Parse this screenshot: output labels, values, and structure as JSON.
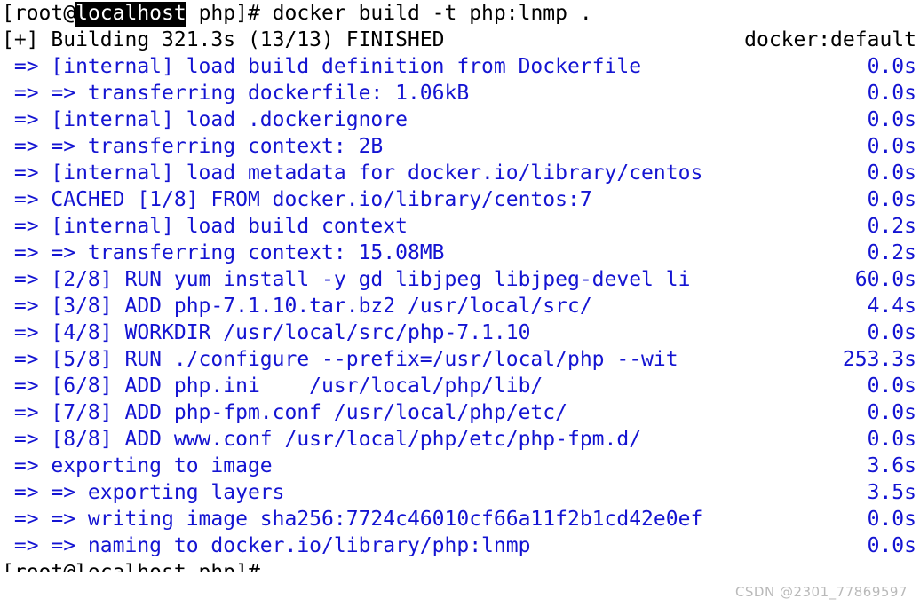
{
  "terminal": {
    "background_color": "#ffffff",
    "default_text_color": "#000000",
    "progress_text_color": "#1414d2",
    "prompt": {
      "prefix": "[root@",
      "host": "localhost",
      "suffix": " php]# ",
      "command": "docker build -t php:lnmp ."
    },
    "status_line": {
      "text": "[+] Building 321.3s (13/13) FINISHED",
      "right": "docker:default"
    },
    "trailing_prompt": "[root@localhost php]# ",
    "lines": [
      {
        "text": " => [internal] load build definition from Dockerfile",
        "time": "0.0s",
        "color": "blue"
      },
      {
        "text": " => => transferring dockerfile: 1.06kB",
        "time": "0.0s",
        "color": "blue"
      },
      {
        "text": " => [internal] load .dockerignore",
        "time": "0.0s",
        "color": "blue"
      },
      {
        "text": " => => transferring context: 2B",
        "time": "0.0s",
        "color": "blue"
      },
      {
        "text": " => [internal] load metadata for docker.io/library/centos",
        "time": "0.0s",
        "color": "blue"
      },
      {
        "text": " => CACHED [1/8] FROM docker.io/library/centos:7",
        "time": "0.0s",
        "color": "blue"
      },
      {
        "text": " => [internal] load build context",
        "time": "0.2s",
        "color": "blue"
      },
      {
        "text": " => => transferring context: 15.08MB",
        "time": "0.2s",
        "color": "blue"
      },
      {
        "text": " => [2/8] RUN yum install -y gd libjpeg libjpeg-devel li",
        "time": "60.0s",
        "color": "blue"
      },
      {
        "text": " => [3/8] ADD php-7.1.10.tar.bz2 /usr/local/src/",
        "time": "4.4s",
        "color": "blue"
      },
      {
        "text": " => [4/8] WORKDIR /usr/local/src/php-7.1.10",
        "time": "0.0s",
        "color": "blue"
      },
      {
        "text": " => [5/8] RUN ./configure --prefix=/usr/local/php --wit",
        "time": "253.3s",
        "color": "blue"
      },
      {
        "text": " => [6/8] ADD php.ini    /usr/local/php/lib/",
        "time": "0.0s",
        "color": "blue"
      },
      {
        "text": " => [7/8] ADD php-fpm.conf /usr/local/php/etc/",
        "time": "0.0s",
        "color": "blue"
      },
      {
        "text": " => [8/8] ADD www.conf /usr/local/php/etc/php-fpm.d/",
        "time": "0.0s",
        "color": "blue"
      },
      {
        "text": " => exporting to image",
        "time": "3.6s",
        "color": "blue"
      },
      {
        "text": " => => exporting layers",
        "time": "3.5s",
        "color": "blue"
      },
      {
        "text": " => => writing image sha256:7724c46010cf66a11f2b1cd42e0ef",
        "time": "0.0s",
        "color": "blue"
      },
      {
        "text": " => => naming to docker.io/library/php:lnmp",
        "time": "0.0s",
        "color": "blue"
      }
    ]
  },
  "watermark": {
    "text": "CSDN @2301_77869597"
  }
}
